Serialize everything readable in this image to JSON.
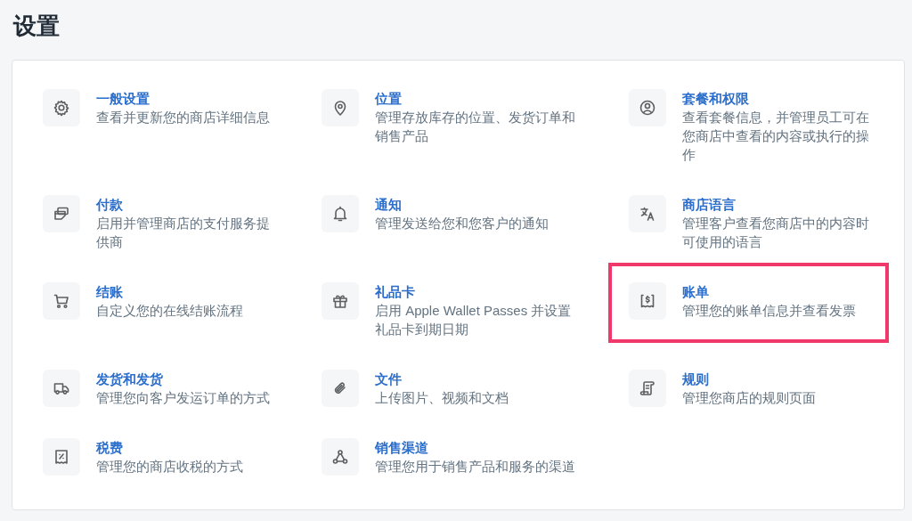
{
  "page_title": "设置",
  "settings": [
    {
      "title": "一般设置",
      "description": "查看并更新您的商店详细信息",
      "highlighted": false
    },
    {
      "title": "位置",
      "description": "管理存放库存的位置、发货订单和销售产品",
      "highlighted": false
    },
    {
      "title": "套餐和权限",
      "description": "查看套餐信息，并管理员工可在您商店中查看的内容或执行的操作",
      "highlighted": false
    },
    {
      "title": "付款",
      "description": "启用并管理商店的支付服务提供商",
      "highlighted": false
    },
    {
      "title": "通知",
      "description": "管理发送给您和您客户的通知",
      "highlighted": false
    },
    {
      "title": "商店语言",
      "description": "管理客户查看您商店中的内容时可使用的语言",
      "highlighted": false
    },
    {
      "title": "结账",
      "description": "自定义您的在线结账流程",
      "highlighted": false
    },
    {
      "title": "礼品卡",
      "description": "启用 Apple Wallet Passes 并设置礼品卡到期日期",
      "highlighted": false
    },
    {
      "title": "账单",
      "description": "管理您的账单信息并查看发票",
      "highlighted": true
    },
    {
      "title": "发货和发货",
      "description": "管理您向客户发运订单的方式",
      "highlighted": false
    },
    {
      "title": "文件",
      "description": "上传图片、视频和文档",
      "highlighted": false
    },
    {
      "title": "规则",
      "description": "管理您商店的规则页面",
      "highlighted": false
    },
    {
      "title": "税费",
      "description": "管理您的商店收税的方式",
      "highlighted": false
    },
    {
      "title": "销售渠道",
      "description": "管理您用于销售产品和服务的渠道",
      "highlighted": false
    }
  ]
}
